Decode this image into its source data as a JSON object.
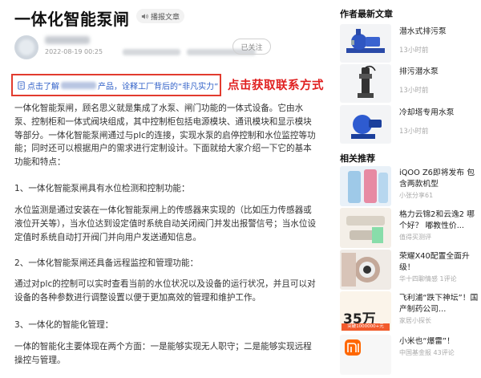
{
  "article": {
    "title": "一体化智能泵闸",
    "listen_label": "播报文章",
    "date": "2022-08-19 00:25",
    "follow_label": "已关注",
    "promo_prefix": "点击了解",
    "promo_suffix": "产品，诠释工厂背后的“非凡实力”",
    "promo_cta": "点击获取联系方式",
    "paragraphs": [
      "一体化智能泵闸，顾名思义就是集成了水泵、闸门功能的一体式设备。它由水泵、控制柜和一体式阀块组成，其中控制柜包括电源模块、通讯模块和显示模块等部分。一体化智能泵闸通过与plc的连接，实现水泵的启停控制和水位监控等功能；同时还可以根据用户的需求进行定制设计。下面就给大家介绍一下它的基本功能和特点：",
      "1、一体化智能泵闸具有水位检测和控制功能：",
      "水位监测是通过安装在一体化智能泵闸上的传感器来实现的（比如压力传感器或液位开关等），当水位达到设定值时系统自动关闭阀门并发出报警信号；当水位设定值时系统自动打开阀门并向用户发送通知信息。",
      "2、一体化智能泵闸还具备远程监控和管理功能：",
      "通过对plc的控制可以实时查看当前的水位状况以及设备的运行状况，并且可以对设备的各种参数进行调整设置以便于更加高效的管理和维护工作。",
      "3、一体化的智能化管理：",
      "一体的智能化主要体现在两个方面：一是能够实现无人职守；二是能够实现远程操控与管理。"
    ]
  },
  "sidebar": {
    "author_latest_title": "作者最新文章",
    "author_articles": [
      {
        "title": "潜水式排污泵",
        "time": "13小时前"
      },
      {
        "title": "排污潜水泵",
        "time": "13小时前"
      },
      {
        "title": "冷却塔专用水泵",
        "time": "13小时前"
      }
    ],
    "related_title": "相关推荐",
    "related": [
      {
        "title": "iQOO Z6即将发布 包含两款机型",
        "meta": "小张分享61"
      },
      {
        "title": "格力云锦2和云逸2 哪个好？ 嘟教性价...",
        "meta": "值得买测评"
      },
      {
        "title": "荣耀X40配置全面升级！",
        "meta": "华十四聊情感   1评论"
      },
      {
        "title": "飞利浦“跌下神坛”！国产制药公司...",
        "meta": "家居小探长"
      },
      {
        "title": "小米也“爆雷”！",
        "meta": "中国基金报   43评论"
      }
    ],
    "ad_price": "35万",
    "ad_sub": "突破1000000+元"
  },
  "colors": {
    "promo_border": "#e23b2e",
    "promo_link": "#3060c8",
    "promo_cta": "#e02020"
  }
}
